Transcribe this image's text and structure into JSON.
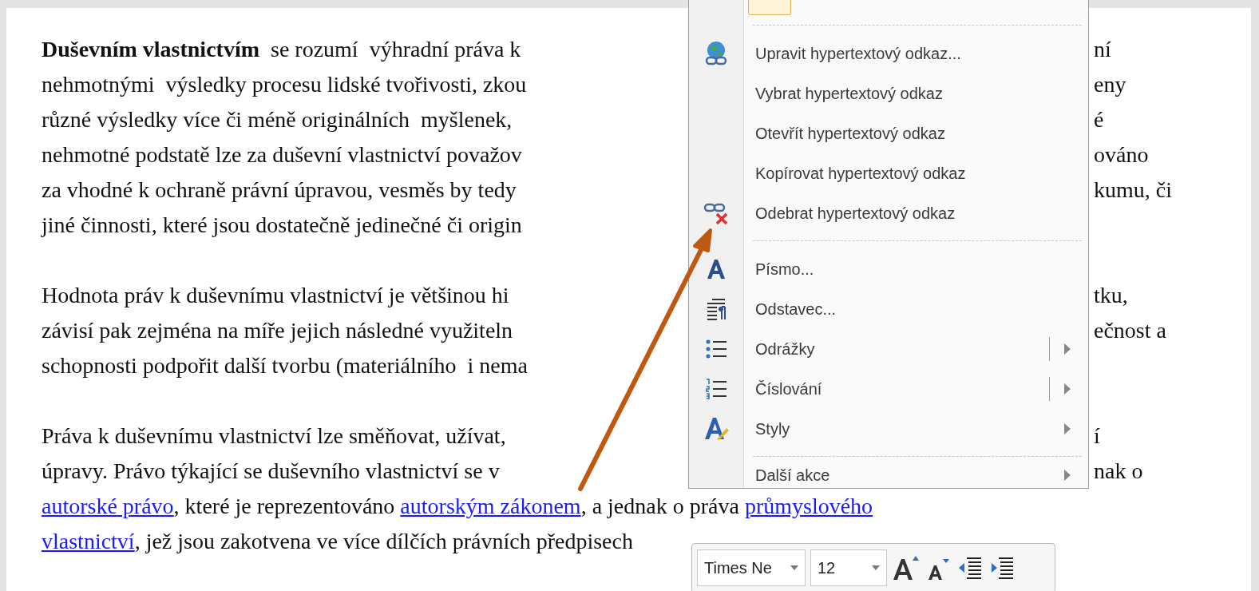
{
  "document": {
    "paragraphs": [
      {
        "lines": [
          {
            "left": [
              {
                "text": "**Duševním vlastnictvím**  se rozumí  výhradní práva k",
                "link": false
              }
            ],
            "right": "ní"
          },
          {
            "left": [
              {
                "text": "nehmotnými  výsledky procesu lidské tvořivosti, zkou",
                "link": false
              }
            ],
            "right": "eny"
          },
          {
            "left": [
              {
                "text": "různé výsledky více či méně originálních  myšlenek,",
                "link": false
              }
            ],
            "right": "é"
          },
          {
            "left": [
              {
                "text": "nehmotné podstatě lze za duševní vlastnictví považov",
                "link": false
              }
            ],
            "right": "ováno"
          },
          {
            "left": [
              {
                "text": "za vhodné k ochraně právní úpravou, vesměs by tedy",
                "link": false
              }
            ],
            "right": "kumu, či"
          },
          {
            "left": [
              {
                "text": "jiné činnosti, které jsou dostatečně jedinečné či origin",
                "link": false
              }
            ]
          }
        ]
      },
      {
        "lines": [
          {
            "left": [
              {
                "text": "Hodnota práv k duševnímu vlastnictví je většinou hi",
                "link": false
              }
            ],
            "right": "tku,"
          },
          {
            "left": [
              {
                "text": "závisí pak zejména na míře jejich následné využiteln",
                "link": false
              }
            ],
            "right": "ečnost a"
          },
          {
            "left": [
              {
                "text": "schopnosti podpořit další tvorbu (materiálního  i nema",
                "link": false
              }
            ]
          }
        ]
      },
      {
        "lines": [
          {
            "left": [
              {
                "text": "Práva k duševnímu vlastnictví lze směňovat, užívat,",
                "link": false
              }
            ],
            "right": "í"
          },
          {
            "left": [
              {
                "text": "úpravy. Právo týkající se duševního vlastnictví se v",
                "link": false
              }
            ],
            "right": "nak o"
          },
          {
            "left": [
              {
                "text": "autorské právo",
                "link": true
              },
              {
                "text": ", které je reprezentováno ",
                "link": false
              },
              {
                "text": "autorským zákonem",
                "link": true
              },
              {
                "text": ", a jednak o práva ",
                "link": false
              },
              {
                "text": "průmyslového",
                "link": true
              }
            ]
          },
          {
            "left": [
              {
                "text": "vlastnictví",
                "link": true
              },
              {
                "text": ", jež jsou zakotvena ve více dílčích právních předpisech",
                "link": false
              }
            ]
          }
        ]
      }
    ]
  },
  "context_menu": {
    "items": [
      {
        "kind": "separator"
      },
      {
        "kind": "command",
        "label": "Upravit hypertextový odkaz..."
      },
      {
        "kind": "command",
        "label": "Vybrat hypertextový odkaz"
      },
      {
        "kind": "command",
        "label": "Otevřít hypertextový odkaz"
      },
      {
        "kind": "command",
        "label": "Kopírovat hypertextový odkaz"
      },
      {
        "kind": "command",
        "label": "Odebrat hypertextový odkaz"
      },
      {
        "kind": "separator"
      },
      {
        "kind": "command",
        "label": "Písmo..."
      },
      {
        "kind": "command",
        "label": "Odstavec..."
      },
      {
        "kind": "split-submenu",
        "label": "Odrážky"
      },
      {
        "kind": "split-submenu",
        "label": "Číslování"
      },
      {
        "kind": "submenu",
        "label": "Styly"
      },
      {
        "kind": "separator"
      },
      {
        "kind": "submenu",
        "label": "Další akce"
      }
    ]
  },
  "mini_toolbar": {
    "font": "Times Ne",
    "size": "12"
  }
}
